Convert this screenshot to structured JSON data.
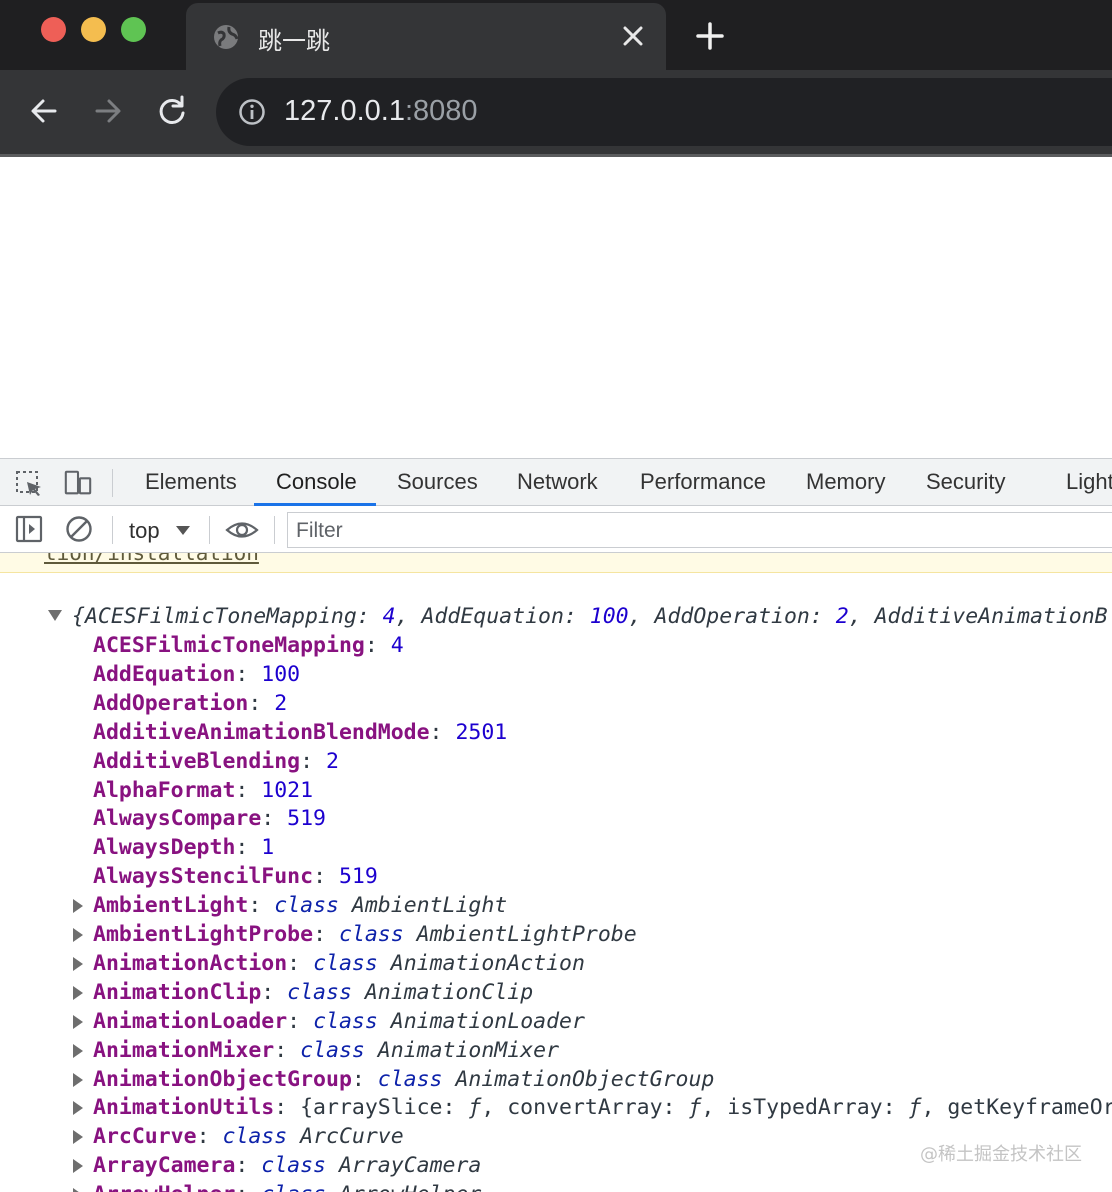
{
  "browser": {
    "tab_title": "跳一跳",
    "url_host": "127.0.0.1",
    "url_port": ":8080"
  },
  "devtools": {
    "tabs": [
      "Elements",
      "Console",
      "Sources",
      "Network",
      "Performance",
      "Memory",
      "Security",
      "Light"
    ],
    "active_tab": "Console",
    "context": "top",
    "filter_placeholder": "Filter"
  },
  "console": {
    "warning_link": "tion/installation",
    "summary": {
      "open": "{",
      "parts": [
        {
          "k": "ACESFilmicToneMapping",
          "v": "4"
        },
        {
          "k": "AddEquation",
          "v": "100"
        },
        {
          "k": "AddOperation",
          "v": "2"
        },
        {
          "k": "AdditiveAnimationB",
          "v": ""
        }
      ]
    },
    "props": [
      {
        "key": "ACESFilmicToneMapping",
        "type": "num",
        "value": "4"
      },
      {
        "key": "AddEquation",
        "type": "num",
        "value": "100"
      },
      {
        "key": "AddOperation",
        "type": "num",
        "value": "2"
      },
      {
        "key": "AdditiveAnimationBlendMode",
        "type": "num",
        "value": "2501"
      },
      {
        "key": "AdditiveBlending",
        "type": "num",
        "value": "2"
      },
      {
        "key": "AlphaFormat",
        "type": "num",
        "value": "1021"
      },
      {
        "key": "AlwaysCompare",
        "type": "num",
        "value": "519"
      },
      {
        "key": "AlwaysDepth",
        "type": "num",
        "value": "1"
      },
      {
        "key": "AlwaysStencilFunc",
        "type": "num",
        "value": "519"
      },
      {
        "key": "AmbientLight",
        "type": "class",
        "value": "AmbientLight"
      },
      {
        "key": "AmbientLightProbe",
        "type": "class",
        "value": "AmbientLightProbe"
      },
      {
        "key": "AnimationAction",
        "type": "class",
        "value": "AnimationAction"
      },
      {
        "key": "AnimationClip",
        "type": "class",
        "value": "AnimationClip"
      },
      {
        "key": "AnimationLoader",
        "type": "class",
        "value": "AnimationLoader"
      },
      {
        "key": "AnimationMixer",
        "type": "class",
        "value": "AnimationMixer"
      },
      {
        "key": "AnimationObjectGroup",
        "type": "class",
        "value": "AnimationObjectGroup"
      },
      {
        "key": "AnimationUtils",
        "type": "obj",
        "value": "{arraySlice: ƒ, convertArray: ƒ, isTypedArray: ƒ, getKeyframeOr"
      },
      {
        "key": "ArcCurve",
        "type": "class",
        "value": "ArcCurve"
      },
      {
        "key": "ArrayCamera",
        "type": "class",
        "value": "ArrayCamera"
      },
      {
        "key": "ArrowHelper",
        "type": "class",
        "value": "ArrowHelper"
      }
    ],
    "class_keyword": "class"
  },
  "watermark": "@稀土掘金技术社区"
}
